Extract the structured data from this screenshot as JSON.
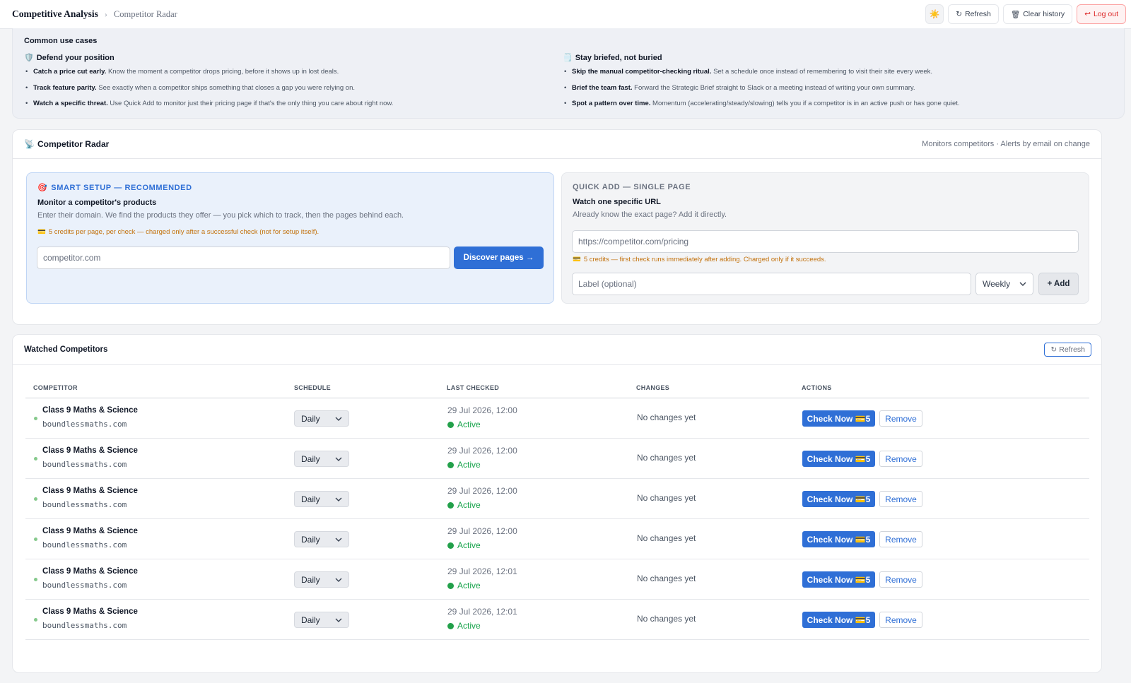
{
  "breadcrumb": {
    "root": "Competitive Analysis",
    "separator": "›",
    "current": "Competitor Radar"
  },
  "topbar": {
    "theme_icon": "☀️",
    "refresh_label": "Refresh",
    "refresh_icon": "↻",
    "clear_label": "Clear history",
    "clear_icon": "🗑",
    "logout_label": "Log out",
    "logout_icon": "↩"
  },
  "usecases": {
    "title": "Common use cases",
    "left": {
      "icon": "🛡️",
      "heading": "Defend your position",
      "items": [
        {
          "bold": "Catch a price cut early.",
          "text": "Know the moment a competitor drops pricing, before it shows up in lost deals."
        },
        {
          "bold": "Track feature parity.",
          "text": "See exactly when a competitor ships something that closes a gap you were relying on."
        },
        {
          "bold": "Watch a specific threat.",
          "text": "Use Quick Add to monitor just their pricing page if that's the only thing you care about right now."
        }
      ]
    },
    "right": {
      "icon": "🗒️",
      "heading": "Stay briefed, not buried",
      "items": [
        {
          "bold": "Skip the manual competitor-checking ritual.",
          "text": "Set a schedule once instead of remembering to visit their site every week."
        },
        {
          "bold": "Brief the team fast.",
          "text": "Forward the Strategic Brief straight to Slack or a meeting instead of writing your own summary."
        },
        {
          "bold": "Spot a pattern over time.",
          "text": "Momentum (accelerating/steady/slowing) tells you if a competitor is in an active push or has gone quiet."
        }
      ]
    }
  },
  "radar": {
    "icon": "📡",
    "title": "Competitor Radar",
    "subtitle": "Monitors competitors · Alerts by email on change",
    "smart": {
      "icon": "🎯",
      "kicker": "SMART SETUP — RECOMMENDED",
      "title": "Monitor a competitor's products",
      "desc": "Enter their domain. We find the products they offer — you pick which to track, then the pages behind each.",
      "credit_icon": "💳",
      "credit": "5 credits per page, per check — charged only after a successful check (not for setup itself).",
      "placeholder": "competitor.com",
      "button": "Discover pages →"
    },
    "quick": {
      "kicker": "QUICK ADD — SINGLE PAGE",
      "title": "Watch one specific URL",
      "desc": "Already know the exact page? Add it directly.",
      "url_placeholder": "https://competitor.com/pricing",
      "credit_icon": "💳",
      "credit": "5 credits — first check runs immediately after adding. Charged only if it succeeds.",
      "label_placeholder": "Label (optional)",
      "schedule": "Weekly",
      "add_button": "+ Add"
    }
  },
  "watched": {
    "title": "Watched Competitors",
    "refresh_icon": "↻",
    "refresh_label": "Refresh",
    "columns": [
      "COMPETITOR",
      "SCHEDULE",
      "LAST CHECKED",
      "CHANGES",
      "ACTIONS"
    ],
    "rows": [
      {
        "name": "Class 9 Maths & Science",
        "domain": "boundlessmaths.com",
        "schedule": "Daily",
        "last_checked": "29 Jul 2026, 12:00",
        "status": "Active",
        "changes": "No changes yet",
        "check": "Check Now 💳5",
        "remove": "Remove"
      },
      {
        "name": "Class 9 Maths & Science",
        "domain": "boundlessmaths.com",
        "schedule": "Daily",
        "last_checked": "29 Jul 2026, 12:00",
        "status": "Active",
        "changes": "No changes yet",
        "check": "Check Now 💳5",
        "remove": "Remove"
      },
      {
        "name": "Class 9 Maths & Science",
        "domain": "boundlessmaths.com",
        "schedule": "Daily",
        "last_checked": "29 Jul 2026, 12:00",
        "status": "Active",
        "changes": "No changes yet",
        "check": "Check Now 💳5",
        "remove": "Remove"
      },
      {
        "name": "Class 9 Maths & Science",
        "domain": "boundlessmaths.com",
        "schedule": "Daily",
        "last_checked": "29 Jul 2026, 12:00",
        "status": "Active",
        "changes": "No changes yet",
        "check": "Check Now 💳5",
        "remove": "Remove"
      },
      {
        "name": "Class 9 Maths & Science",
        "domain": "boundlessmaths.com",
        "schedule": "Daily",
        "last_checked": "29 Jul 2026, 12:01",
        "status": "Active",
        "changes": "No changes yet",
        "check": "Check Now 💳5",
        "remove": "Remove"
      },
      {
        "name": "Class 9 Maths & Science",
        "domain": "boundlessmaths.com",
        "schedule": "Daily",
        "last_checked": "29 Jul 2026, 12:01",
        "status": "Active",
        "changes": "No changes yet",
        "check": "Check Now 💳5",
        "remove": "Remove"
      }
    ]
  },
  "colors": {
    "accent": "#2f6fd6",
    "active": "#16a34a",
    "credit": "#c2700a",
    "danger": "#dc2626"
  }
}
